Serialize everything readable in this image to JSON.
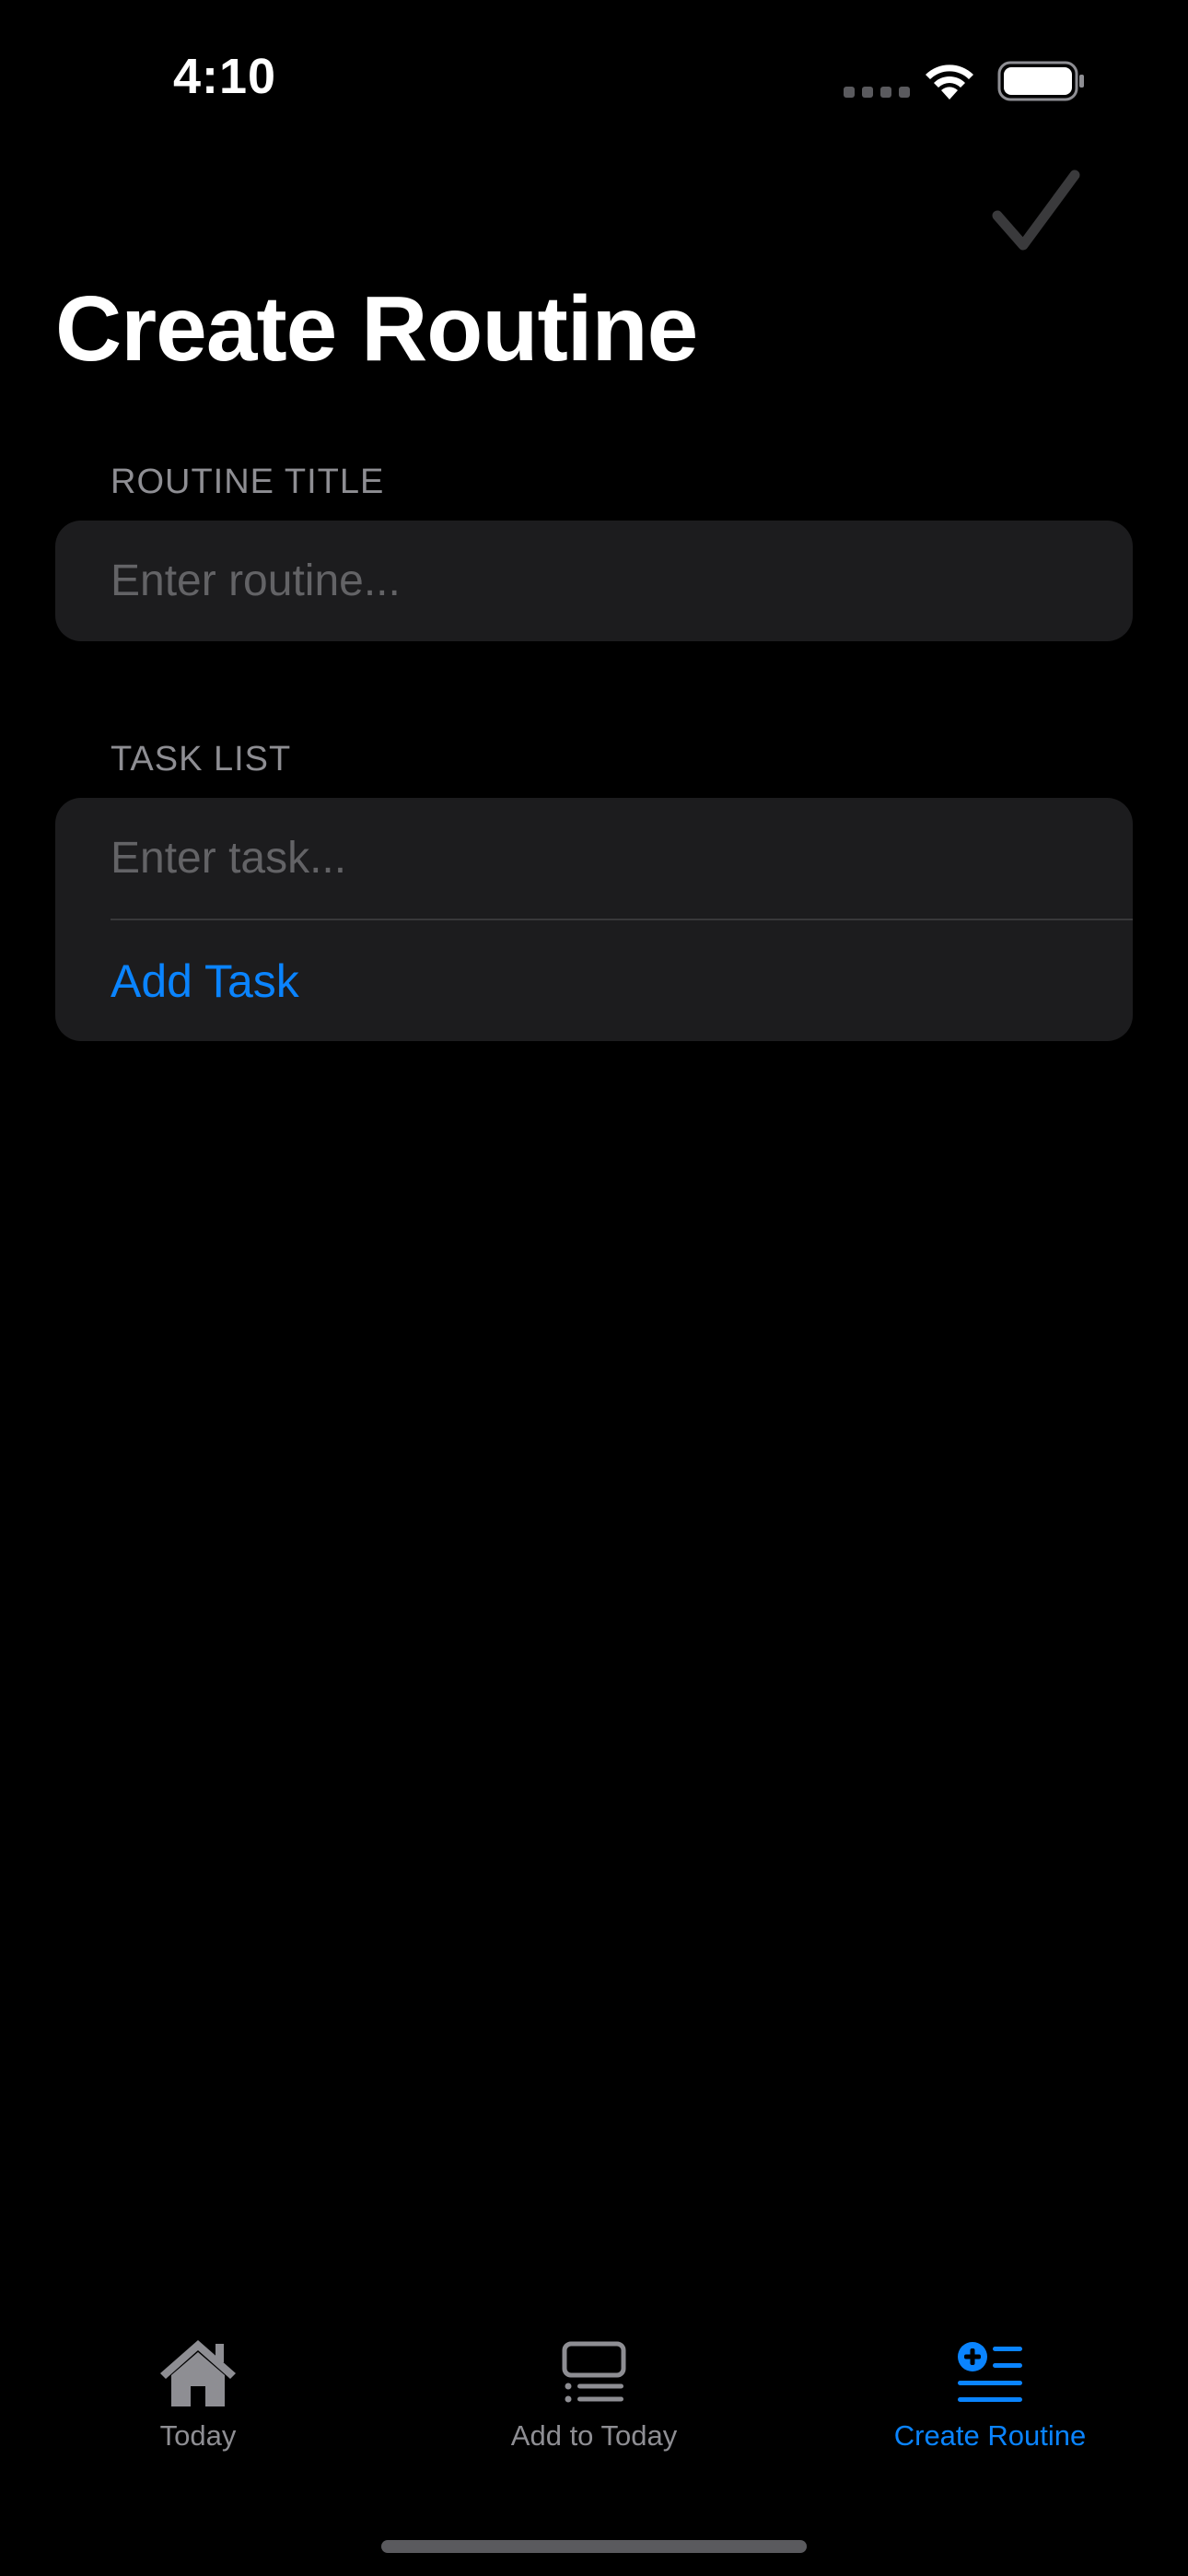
{
  "status_bar": {
    "time": "4:10"
  },
  "nav": {
    "done_icon": "checkmark-icon",
    "title": "Create Routine"
  },
  "form": {
    "routine_section": {
      "header": "ROUTINE TITLE",
      "placeholder": "Enter routine...",
      "value": ""
    },
    "task_section": {
      "header": "TASK LIST",
      "placeholder": "Enter task...",
      "value": "",
      "add_label": "Add Task"
    }
  },
  "tab_bar": {
    "tabs": [
      {
        "label": "Today",
        "icon": "house-icon",
        "active": false
      },
      {
        "label": "Add to Today",
        "icon": "list-add-icon",
        "active": false
      },
      {
        "label": "Create Routine",
        "icon": "create-list-icon",
        "active": true
      }
    ]
  },
  "colors": {
    "background": "#000000",
    "card": "#1c1c1e",
    "accent": "#0a84ff",
    "secondary_text": "#8e8e93",
    "placeholder": "#636366",
    "separator": "#38383a"
  }
}
